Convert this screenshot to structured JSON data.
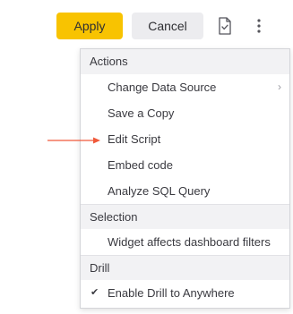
{
  "toolbar": {
    "apply_label": "Apply",
    "cancel_label": "Cancel",
    "script_icon": "script-icon",
    "more_icon": "more-vertical-icon"
  },
  "menu": {
    "sections": [
      {
        "header": "Actions",
        "items": [
          {
            "label": "Change Data Source",
            "has_submenu": true
          },
          {
            "label": "Save a Copy"
          },
          {
            "label": "Edit Script"
          },
          {
            "label": "Embed code"
          },
          {
            "label": "Analyze SQL Query"
          }
        ]
      },
      {
        "header": "Selection",
        "items": [
          {
            "label": "Widget affects dashboard filters"
          }
        ]
      },
      {
        "header": "Drill",
        "items": [
          {
            "label": "Enable Drill to Anywhere",
            "checked": true
          }
        ]
      }
    ]
  },
  "annotation": {
    "arrow_color": "#f0593a"
  },
  "colors": {
    "apply_bg": "#f8c301",
    "cancel_bg": "#ececef",
    "header_bg": "#f2f2f4"
  }
}
